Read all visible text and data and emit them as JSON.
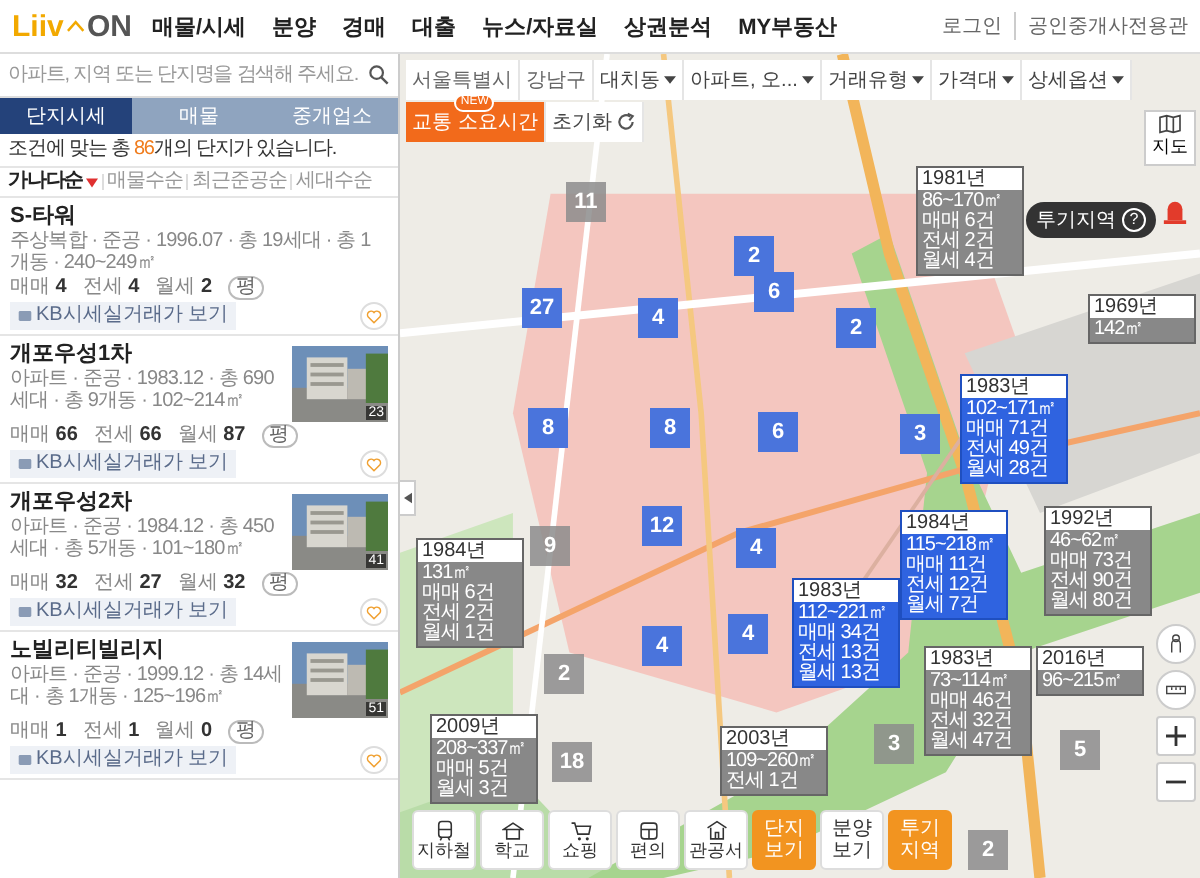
{
  "header": {
    "logo_left": "Liiv",
    "logo_right": "ON",
    "nav": [
      "매물/시세",
      "분양",
      "경매",
      "대출",
      "뉴스/자료실",
      "상권분석",
      "MY부동산"
    ],
    "links": [
      "로그인",
      "공인중개사전용관"
    ]
  },
  "search": {
    "placeholder": "아파트, 지역 또는 단지명을 검색해 주세요."
  },
  "tabs": [
    {
      "label": "단지시세",
      "selected": true
    },
    {
      "label": "매물",
      "selected": false
    },
    {
      "label": "중개업소",
      "selected": false
    }
  ],
  "result": "조건에 맞는 총 **86**개의 단지가 있습니다.",
  "sort": [
    {
      "label": "가나다순",
      "selected": true
    },
    {
      "label": "매물수순",
      "selected": false
    },
    {
      "label": "최근준공순",
      "selected": false
    },
    {
      "label": "세대수순",
      "selected": false
    }
  ],
  "listings": [
    {
      "name": "S-타워",
      "info": "주상복합 · 준공 · 1996.07 · 총 19세대 · 총 1개동 · 240~249㎡",
      "unit": "평",
      "counts": [
        {
          "label": "매매",
          "value": "4"
        },
        {
          "label": "전세",
          "value": "4"
        },
        {
          "label": "월세",
          "value": "2"
        }
      ],
      "kb": "KB시세실거래가 보기"
    },
    {
      "name": "개포우성1차",
      "info": "아파트 · 준공 · 1983.12 · 총 690세대 · 총 9개동 · 102~214㎡",
      "unit": "평",
      "counts": [
        {
          "label": "매매",
          "value": "66"
        },
        {
          "label": "전세",
          "value": "66"
        },
        {
          "label": "월세",
          "value": "87"
        }
      ],
      "kb": "KB시세실거래가 보기",
      "photo": {
        "kind": "picture",
        "count": "23"
      }
    },
    {
      "name": "개포우성2차",
      "info": "아파트 · 준공 · 1984.12 · 총 450세대 · 총 5개동 · 101~180㎡",
      "unit": "평",
      "counts": [
        {
          "label": "매매",
          "value": "32"
        },
        {
          "label": "전세",
          "value": "27"
        },
        {
          "label": "월세",
          "value": "32"
        }
      ],
      "kb": "KB시세실거래가 보기",
      "photo": {
        "kind": "picture",
        "count": "41"
      }
    },
    {
      "name": "노빌리티빌리지",
      "info": "아파트 · 준공 · 1999.12 · 총 14세대 · 총 1개동 · 125~196㎡",
      "unit": "평",
      "counts": [
        {
          "label": "매매",
          "value": "1"
        },
        {
          "label": "전세",
          "value": "1"
        },
        {
          "label": "월세",
          "value": "0"
        }
      ],
      "kb": "KB시세실거래가 보기",
      "photo": {
        "kind": "picture",
        "count": "51"
      }
    }
  ],
  "toolbar": [
    {
      "label": "서울특별시",
      "kind": "crumb"
    },
    {
      "label": "강남구",
      "kind": "crumb"
    },
    {
      "label": "대치동",
      "kind": "dropdown"
    },
    {
      "label": "아파트, 오...",
      "kind": "dropdown"
    },
    {
      "label": "거래유형",
      "kind": "dropdown"
    },
    {
      "label": "가격대",
      "kind": "dropdown"
    },
    {
      "label": "상세옵션",
      "kind": "dropdown"
    },
    {
      "label": "교통 소요시간",
      "kind": "highlight",
      "badge": "NEW"
    },
    {
      "label": "초기화",
      "kind": "reset"
    }
  ],
  "map": {
    "clusters": [
      {
        "label": "11",
        "highlighted": false
      },
      {
        "label": "27",
        "highlighted": true
      },
      {
        "label": "4",
        "highlighted": true
      },
      {
        "label": "2",
        "highlighted": true
      },
      {
        "label": "6",
        "highlighted": true
      },
      {
        "label": "2",
        "highlighted": true
      },
      {
        "label": "8",
        "highlighted": true
      },
      {
        "label": "8",
        "highlighted": true
      },
      {
        "label": "6",
        "highlighted": true
      },
      {
        "label": "3",
        "highlighted": true
      },
      {
        "label": "9",
        "highlighted": false
      },
      {
        "label": "12",
        "highlighted": true
      },
      {
        "label": "4",
        "highlighted": true
      },
      {
        "label": "4",
        "highlighted": true
      },
      {
        "label": "4",
        "highlighted": true
      },
      {
        "label": "2",
        "highlighted": false
      },
      {
        "label": "18",
        "highlighted": false
      },
      {
        "label": "3",
        "highlighted": false
      },
      {
        "label": "5",
        "highlighted": false
      },
      {
        "label": "2",
        "highlighted": false
      }
    ],
    "cards": [
      {
        "year": "1981년",
        "lines": [
          "86~170㎡",
          "매매 6건",
          "전세 2건",
          "월세 4건"
        ],
        "highlighted": false
      },
      {
        "year": "1969년",
        "lines": [
          "142㎡"
        ],
        "highlighted": false
      },
      {
        "year": "1983년",
        "lines": [
          "102~171㎡",
          "매매 71건",
          "전세 49건",
          "월세 28건"
        ],
        "highlighted": true
      },
      {
        "year": "1984년",
        "lines": [
          "115~218㎡",
          "매매 11건",
          "전세 12건",
          "월세 7건"
        ],
        "highlighted": true
      },
      {
        "year": "1983년",
        "lines": [
          "112~221㎡",
          "매매 34건",
          "전세 13건",
          "월세 13건"
        ],
        "highlighted": true
      },
      {
        "year": "1992년",
        "lines": [
          "46~62㎡",
          "매매 73건",
          "전세 90건",
          "월세 80건"
        ],
        "highlighted": false
      },
      {
        "year": "1984년",
        "lines": [
          "131㎡",
          "매매 6건",
          "전세 2건",
          "월세 1건"
        ],
        "highlighted": false
      },
      {
        "year": "1983년",
        "lines": [
          "73~114㎡",
          "매매 46건",
          "전세 32건",
          "월세 47건"
        ],
        "highlighted": false
      },
      {
        "year": "2016년",
        "lines": [
          "96~215㎡"
        ],
        "highlighted": false
      },
      {
        "year": "2009년",
        "lines": [
          "208~337㎡",
          "매매 5건",
          "월세 3건"
        ],
        "highlighted": false
      },
      {
        "year": "2003년",
        "lines": [
          "109~260㎡",
          "전세 1건"
        ],
        "highlighted": false
      }
    ],
    "map_button": "지도",
    "zone_badge": {
      "label": "투기지역",
      "help": "?"
    },
    "bottom_tools": [
      {
        "label": "지하철",
        "kind": "tool"
      },
      {
        "label": "학교",
        "kind": "tool"
      },
      {
        "label": "쇼핑",
        "kind": "tool"
      },
      {
        "label": "편의",
        "kind": "tool"
      },
      {
        "label": "관공서",
        "kind": "tool"
      },
      {
        "label": "단지 보기",
        "kind": "toggle",
        "selected": true
      },
      {
        "label": "분양 보기",
        "kind": "toggle",
        "selected": false
      },
      {
        "label": "투기 지역",
        "kind": "toggle",
        "selected": true
      }
    ]
  }
}
